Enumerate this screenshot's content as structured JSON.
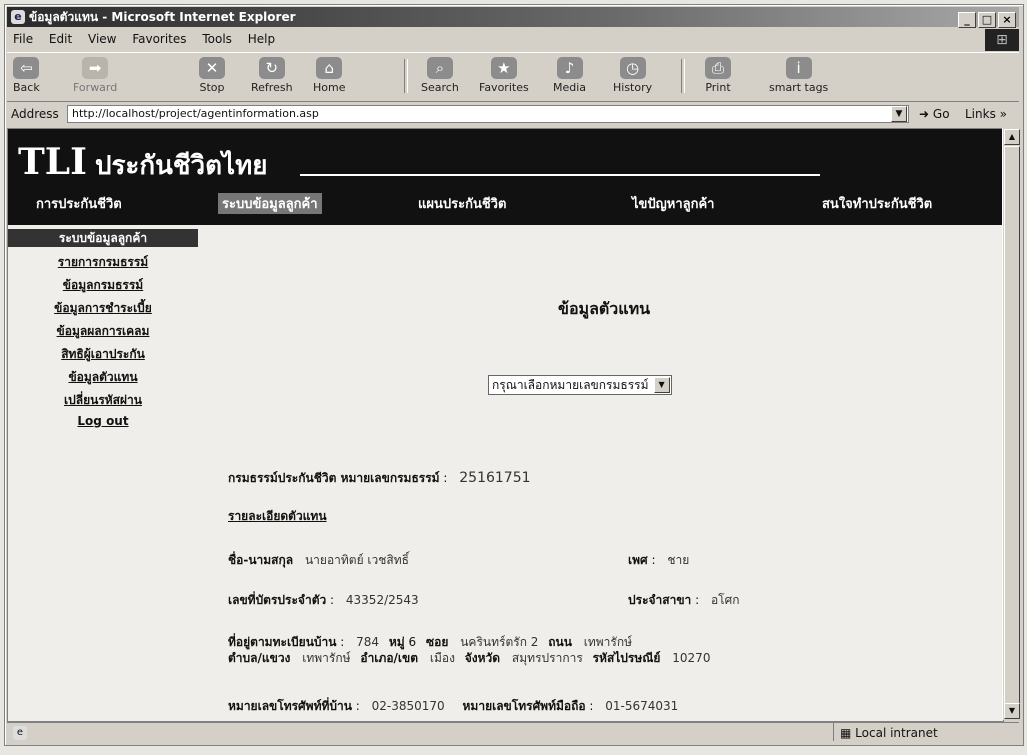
{
  "window": {
    "title": "ข้อมูลตัวแทน - Microsoft Internet Explorer"
  },
  "menu": [
    "File",
    "Edit",
    "View",
    "Favorites",
    "Tools",
    "Help"
  ],
  "toolbar": {
    "back": "Back",
    "forward": "Forward",
    "stop": "Stop",
    "refresh": "Refresh",
    "home": "Home",
    "search": "Search",
    "favorites": "Favorites",
    "media": "Media",
    "history": "History",
    "print": "Print",
    "smarttags": "smart tags"
  },
  "address": {
    "label": "Address",
    "url": "http://localhost/project/agentinformation.asp",
    "go": "Go",
    "links": "Links"
  },
  "site": {
    "logo": "TLI",
    "logo_thai": "ประกันชีวิตไทย",
    "nav": [
      "การประกันชีวิต",
      "ระบบข้อมูลลูกค้า",
      "แผนประกันชีวิต",
      "ไขปัญหาลูกค้า",
      "สนใจทำประกันชีวิต"
    ]
  },
  "sidebar": {
    "items": [
      "ระบบข้อมูลลูกค้า",
      "รายการกรมธรรม์",
      "ข้อมูลกรมธรรม์",
      "ข้อมูลการชำระเบี้ย",
      "ข้อมูลผลการเคลม",
      "สิทธิผู้เอาประกัน",
      "ข้อมูลตัวแทน",
      "เปลี่ยนรหัสผ่าน",
      "Log out"
    ]
  },
  "main": {
    "title": "ข้อมูลตัวแทน",
    "select_value": "กรุณาเลือกหมายเลขกรมธรรม์",
    "policy_label": "กรมธรรม์ประกันชีวิต หมายเลขกรมธรรม์",
    "policy_no": "25161751",
    "detail_heading": "รายละเอียดตัวแทน",
    "name_label": "ชื่อ-นามสกุล",
    "name": "นายอาทิตย์ เวชสิทธิ์",
    "sex_label": "เพศ",
    "sex": "ชาย",
    "id_label": "เลขที่บัตรประจำตัว",
    "id": "43352/2543",
    "branch_label": "ประจำสาขา",
    "branch": "อโศก",
    "addr_label": "ที่อยู่ตามทะเบียนบ้าน",
    "house_no": "784",
    "moo_label": "หมู่",
    "moo": "6",
    "soi_label": "ซอย",
    "soi": "นครินทร์ตรัก 2",
    "road_label": "ถนน",
    "road": "เทพารักษ์",
    "tambon_label": "ตำบล/แขวง",
    "tambon": "เทพารักษ์",
    "amphoe_label": "อำเภอ/เขต",
    "amphoe": "เมือง",
    "province_label": "จังหวัด",
    "province": "สมุทรปราการ",
    "zip_label": "รหัสไปรษณีย์",
    "zip": "10270",
    "home_phone_label": "หมายเลขโทรศัพท์ที่บ้าน",
    "home_phone": "02-3850170",
    "mobile_label": "หมายเลขโทรศัพท์มือถือ",
    "mobile": "01-5674031"
  },
  "status": {
    "zone": "Local intranet"
  }
}
